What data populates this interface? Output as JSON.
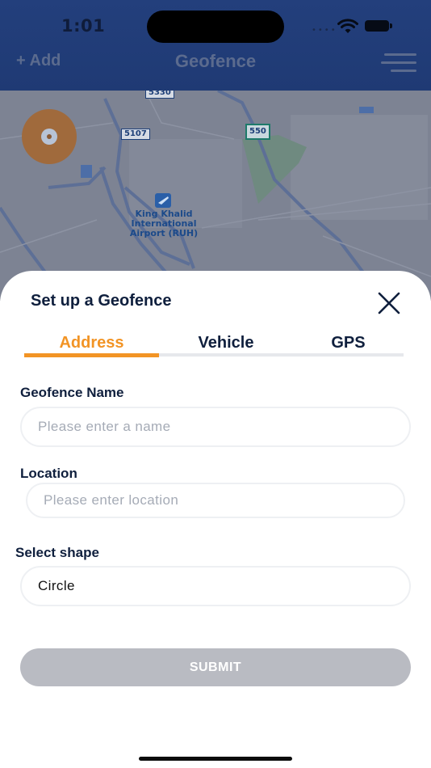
{
  "status_bar": {
    "time": "1:01"
  },
  "header": {
    "add_label": "+ Add",
    "title": "Geofence"
  },
  "map": {
    "road_badges": [
      "5330",
      "5107",
      "550"
    ],
    "airport_label": "King Khalid\nInternational\nAirport (RUH)"
  },
  "sheet": {
    "title": "Set up a Geofence",
    "tabs": [
      {
        "label": "Address",
        "active": true
      },
      {
        "label": "Vehicle",
        "active": false
      },
      {
        "label": "GPS",
        "active": false
      }
    ],
    "fields": {
      "name": {
        "label": "Geofence Name",
        "placeholder": "Please enter a name"
      },
      "location": {
        "label": "Location",
        "placeholder": "Please enter location"
      },
      "shape": {
        "label": "Select shape",
        "value": "Circle"
      }
    },
    "submit_label": "SUBMIT"
  },
  "colors": {
    "accent": "#f29425",
    "header": "#233f7c",
    "text": "#0f1f3d",
    "button_disabled": "#b9bbc2"
  }
}
